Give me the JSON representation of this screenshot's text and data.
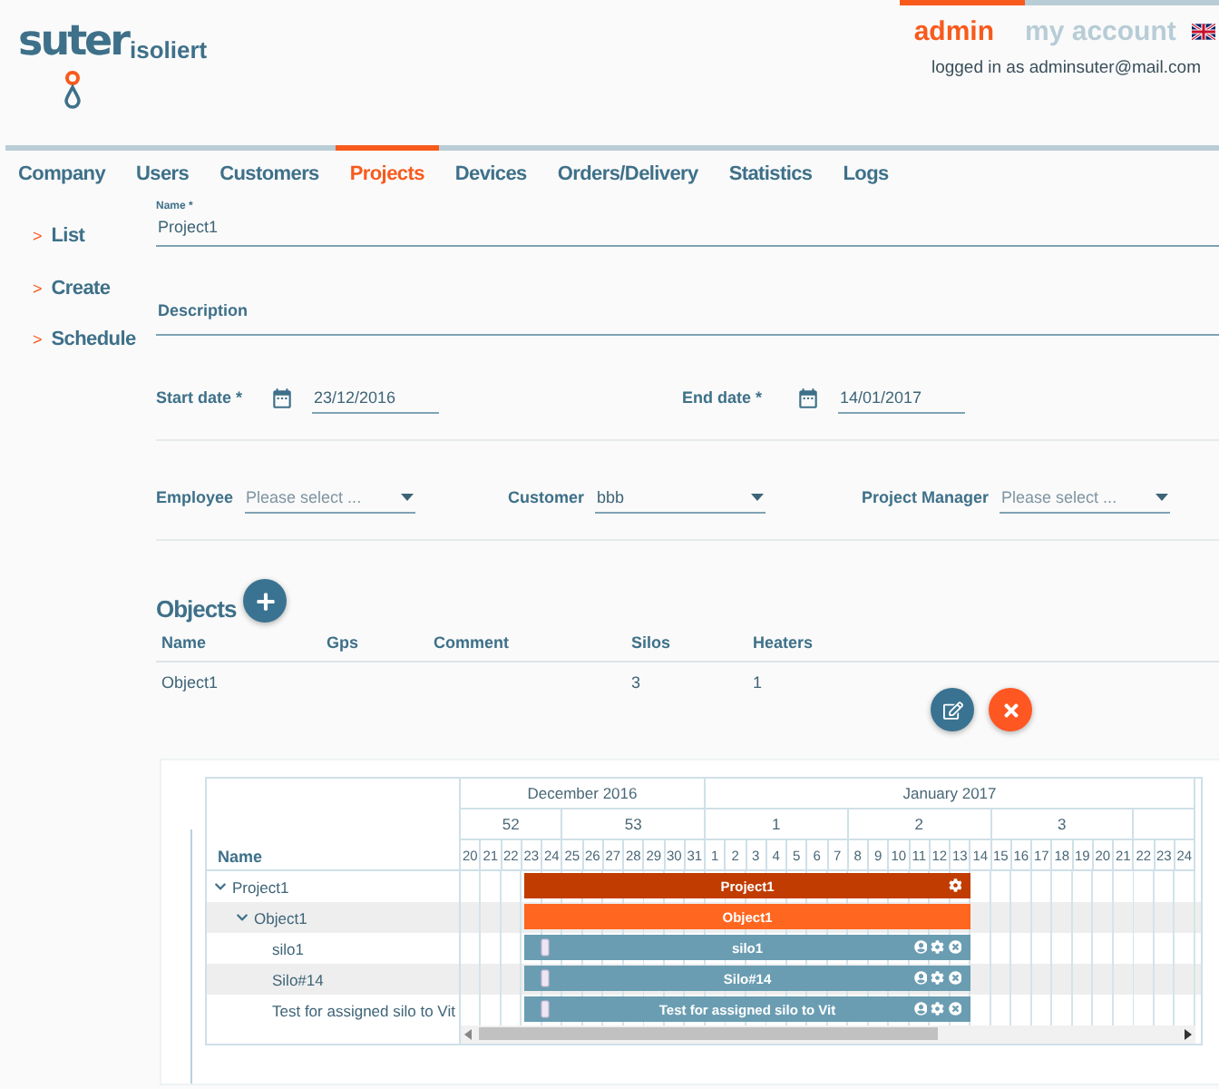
{
  "header": {
    "logo": {
      "main": "suter",
      "sub": "isoliert"
    },
    "account_tabs": [
      {
        "label": "admin",
        "selected": true
      },
      {
        "label": "my account",
        "selected": false
      }
    ],
    "logged_in": "logged in as adminsuter@mail.com"
  },
  "nav": [
    {
      "label": "Company",
      "selected": false
    },
    {
      "label": "Users",
      "selected": false
    },
    {
      "label": "Customers",
      "selected": false
    },
    {
      "label": "Projects",
      "selected": true
    },
    {
      "label": "Devices",
      "selected": false
    },
    {
      "label": "Orders/Delivery",
      "selected": false
    },
    {
      "label": "Statistics",
      "selected": false
    },
    {
      "label": "Logs",
      "selected": false
    }
  ],
  "sidebar": [
    {
      "marker": ">",
      "label": "List"
    },
    {
      "marker": ">",
      "label": "Create"
    },
    {
      "marker": ">",
      "label": "Schedule"
    }
  ],
  "form": {
    "name": {
      "label": "Name *",
      "value": "Project1"
    },
    "description": {
      "label": "Description"
    },
    "dates": [
      {
        "label": "Start date *",
        "value": "23/12/2016"
      },
      {
        "label": "End date *",
        "value": "14/01/2017"
      }
    ],
    "selects": [
      {
        "label": "Employee",
        "placeholder": "Please select ..."
      },
      {
        "label": "Customer",
        "value": "bbb"
      },
      {
        "label": "Project Manager",
        "placeholder": "Please select ..."
      }
    ]
  },
  "objects": {
    "title": "Objects",
    "columns": [
      "Name",
      "Gps",
      "Comment",
      "Silos",
      "Heaters"
    ],
    "rows": [
      {
        "name": "Object1",
        "silos": "3",
        "heaters": "1"
      }
    ]
  },
  "gantt": {
    "name_header": "Name",
    "months": [
      {
        "label": "December 2016",
        "weeks": [
          {
            "label": "52",
            "days": [
              "20",
              "21",
              "22",
              "23",
              "24"
            ]
          },
          {
            "label": "53",
            "days": [
              "25",
              "26",
              "27",
              "28",
              "29",
              "30",
              "31"
            ]
          }
        ]
      },
      {
        "label": "January 2017",
        "weeks": [
          {
            "label": "1",
            "days": [
              "1",
              "2",
              "3",
              "4",
              "5",
              "6",
              "7"
            ]
          },
          {
            "label": "2",
            "days": [
              "8",
              "9",
              "10",
              "11",
              "12",
              "13",
              "14"
            ]
          },
          {
            "label": "3",
            "days": [
              "15",
              "16",
              "17",
              "18",
              "19",
              "20",
              "21"
            ]
          },
          {
            "days": [
              "22",
              "23",
              "24"
            ]
          }
        ]
      }
    ],
    "tree": [
      {
        "name": "Project1",
        "expanded": true,
        "bar": {
          "kind": "project",
          "label": "Project1"
        },
        "children": [
          {
            "name": "Object1",
            "expanded": true,
            "bar": {
              "kind": "object",
              "label": "Object1"
            },
            "children": [
              {
                "name": "silo1",
                "bar": {
                  "kind": "silo",
                  "label": "silo1"
                }
              },
              {
                "name": "Silo#14",
                "bar": {
                  "kind": "silo",
                  "label": "Silo#14"
                }
              },
              {
                "name": "Test for assigned silo to Vit",
                "bar": {
                  "kind": "silo",
                  "label": "Test for assigned silo to Vit"
                }
              }
            ]
          }
        ]
      }
    ]
  }
}
